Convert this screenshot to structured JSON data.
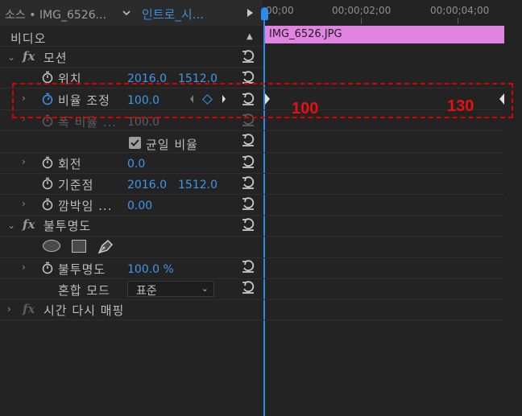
{
  "header": {
    "source_label": "소스 • IMG_6526...",
    "sequence_label": "인트로_시...",
    "dropdown_icon": "chevron-down-icon",
    "play_icon": "play-triangle-icon"
  },
  "ruler": {
    "labels": [
      "00;00",
      "00;00;02;00",
      "00;00;04;00"
    ]
  },
  "clip": {
    "label": "IMG_6526.JPG",
    "color": "#e183e1"
  },
  "panel": {
    "section_title": "비디오",
    "motion": {
      "label": "모션",
      "position": {
        "label": "위치",
        "x": "2016.0",
        "y": "1512.0"
      },
      "scale": {
        "label": "비율 조정",
        "value": "100.0"
      },
      "scale_width": {
        "label": "폭 비율 ...",
        "value": "100.0"
      },
      "uniform_scale": {
        "label": "균일 비율",
        "checked": true
      },
      "rotation": {
        "label": "회전",
        "value": "0.0"
      },
      "anchor": {
        "label": "기준점",
        "x": "2016.0",
        "y": "1512.0"
      },
      "anti_flicker": {
        "label": "깜박임 ...",
        "value": "0.00"
      }
    },
    "opacity": {
      "label": "불투명도",
      "opacity_param": {
        "label": "불투명도",
        "value": "100.0 %"
      },
      "blend_mode": {
        "label": "혼합 모드",
        "value": "표준"
      }
    },
    "time_remap": {
      "label": "시간 다시 매핑"
    }
  },
  "annotations": {
    "left": "100",
    "right": "130",
    "color": "#e81010"
  },
  "colors": {
    "accent": "#3f97ea",
    "playhead": "#2d8ceb",
    "background": "#232323"
  }
}
